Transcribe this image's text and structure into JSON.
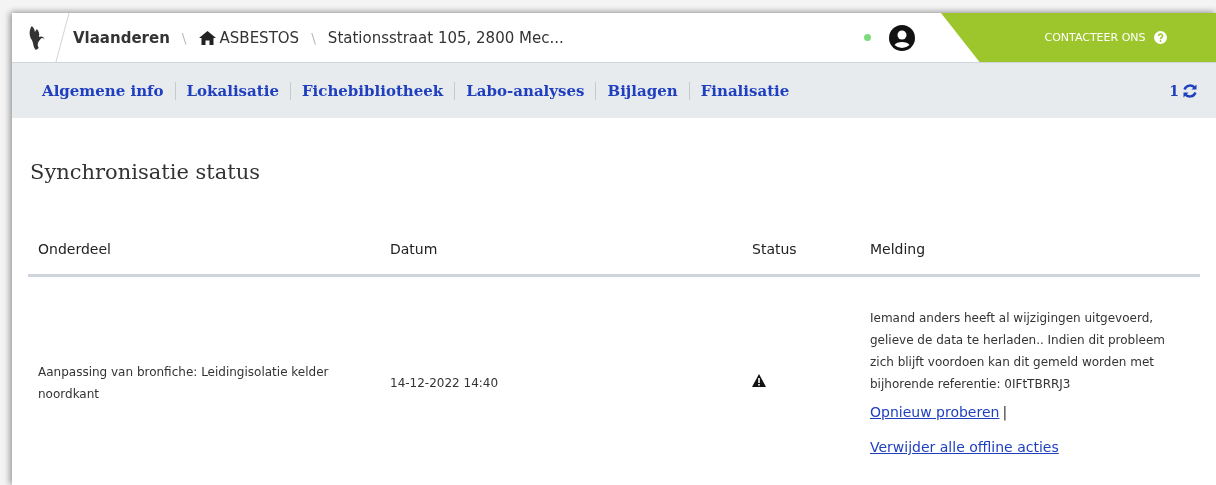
{
  "header": {
    "brand": "Vlaanderen",
    "app": "ASBESTOS",
    "location": "Stationsstraat 105, 2800 Mec...",
    "separators": [
      "\\",
      "\\"
    ],
    "online": true,
    "contact": "CONTACTEER ONS"
  },
  "nav": {
    "tabs": [
      "Algemene info",
      "Lokalisatie",
      "Fichebibliotheek",
      "Labo-analyses",
      "Bijlagen",
      "Finalisatie"
    ],
    "sync_count": "1"
  },
  "title": "Synchronisatie status",
  "table": {
    "columns": [
      "Onderdeel",
      "Datum",
      "Status",
      "Melding"
    ],
    "rows": [
      {
        "onderdeel": "Aanpassing van bronfiche: Leidingisolatie kelder noordkant",
        "datum": "14-12-2022 14:40",
        "status": {
          "kind": "warning"
        },
        "melding": "Iemand anders heeft al wijzigingen uitgevoerd, gelieve de data te herladen.. Indien dit probleem zich blijft voordoen kan dit gemeld worden met bijhorende referentie: 0IFtTBRRJ3",
        "retry": "Opnieuw proberen",
        "separator": "|",
        "delete": "Verwijder alle offline acties"
      }
    ]
  }
}
